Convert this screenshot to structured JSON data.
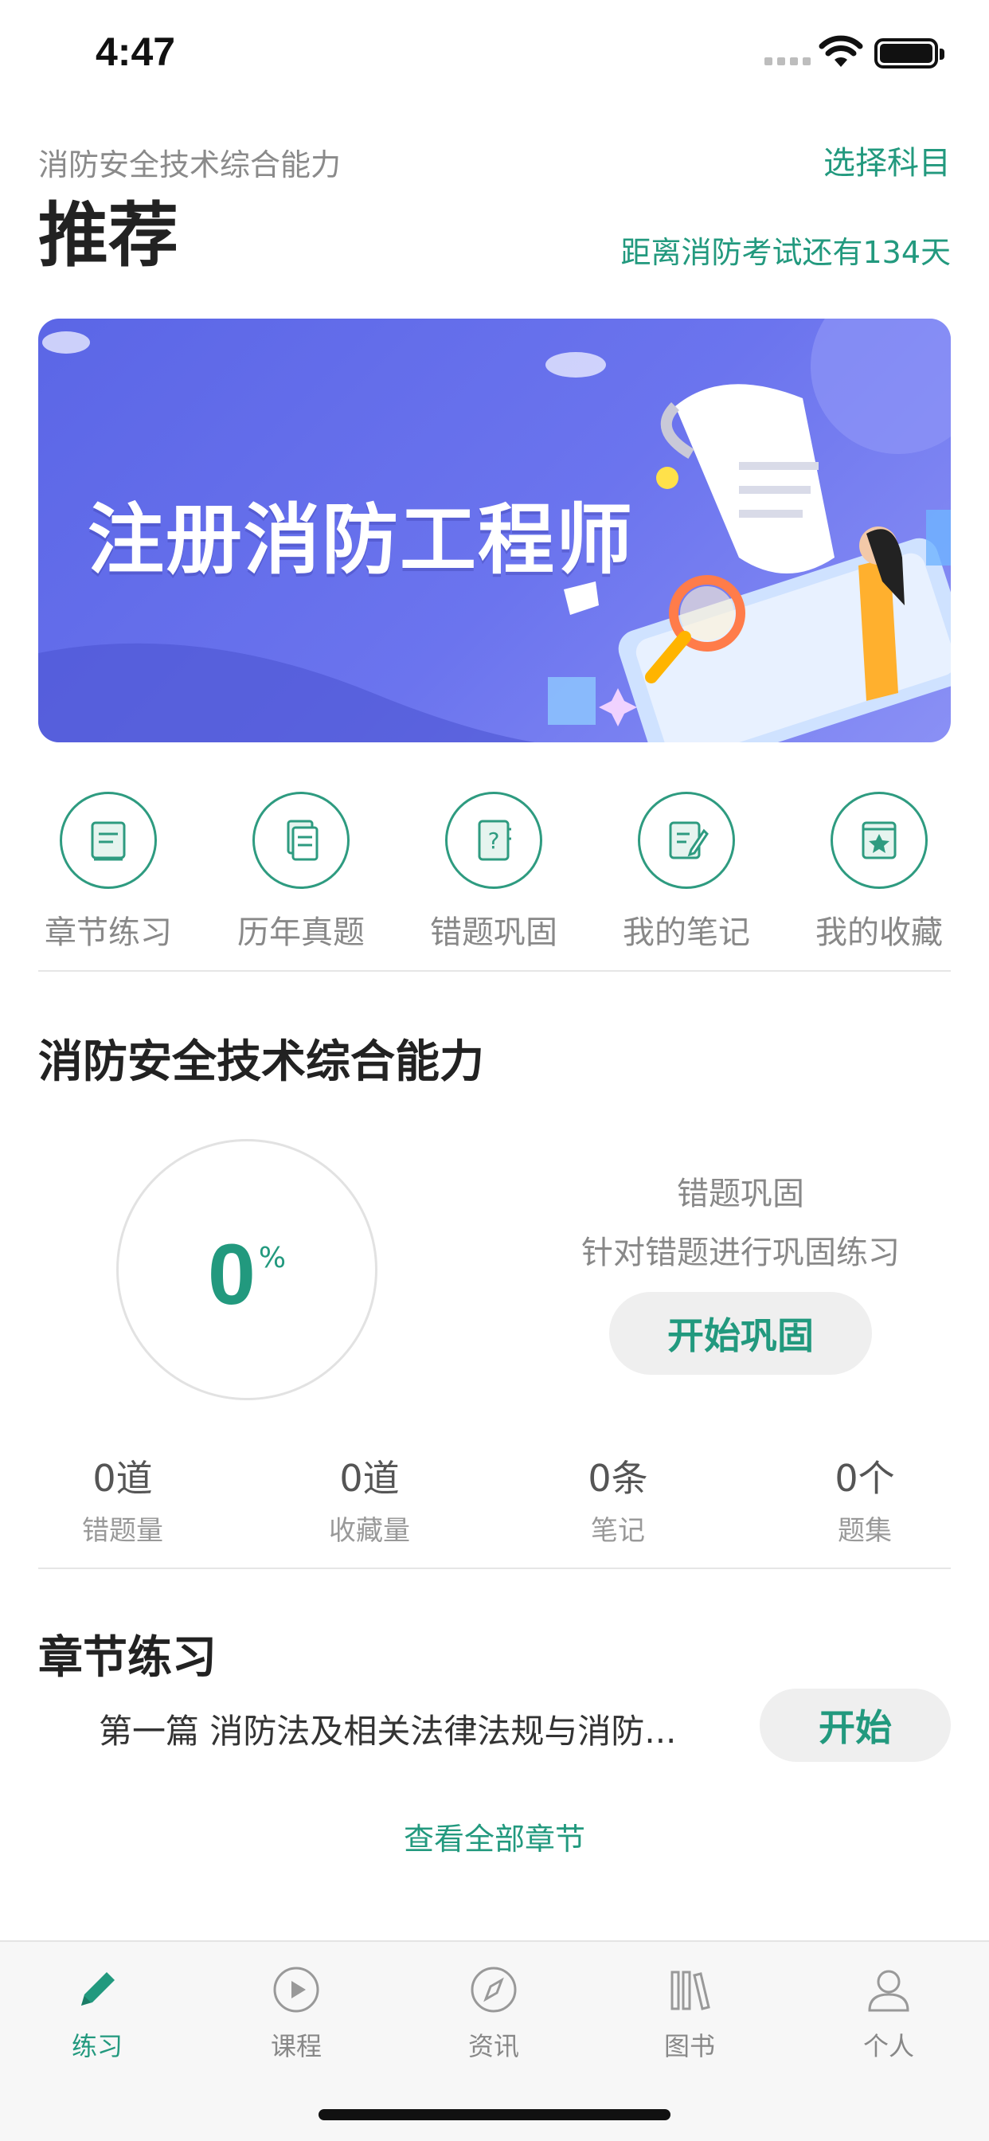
{
  "status_bar": {
    "time": "4:47"
  },
  "header": {
    "subject": "消防安全技术综合能力",
    "choose_subject": "选择科目",
    "title": "推荐",
    "countdown": "距离消防考试还有134天"
  },
  "banner": {
    "headline": "注册消防工程师"
  },
  "quick_actions": [
    {
      "label": "章节练习",
      "icon": "scroll-pen-icon"
    },
    {
      "label": "历年真题",
      "icon": "documents-icon"
    },
    {
      "label": "错题巩固",
      "icon": "question-notebook-icon"
    },
    {
      "label": "我的笔记",
      "icon": "note-edit-icon"
    },
    {
      "label": "我的收藏",
      "icon": "star-book-icon"
    }
  ],
  "stats": {
    "title": "消防安全技术综合能力",
    "progress_value": "0",
    "progress_unit": "%",
    "wrong_title": "错题巩固",
    "wrong_desc": "针对错题进行巩固练习",
    "wrong_button": "开始巩固",
    "counts": [
      {
        "value": "0道",
        "label": "错题量"
      },
      {
        "value": "0道",
        "label": "收藏量"
      },
      {
        "value": "0条",
        "label": "笔记"
      },
      {
        "value": "0个",
        "label": "题集"
      }
    ]
  },
  "chapter": {
    "title": "章节练习",
    "item_name": "第一篇 消防法及相关法律法规与消防...",
    "start_button": "开始",
    "view_all": "查看全部章节"
  },
  "tabbar": [
    {
      "label": "练习",
      "icon": "pencil-icon",
      "active": true
    },
    {
      "label": "课程",
      "icon": "play-circle-icon",
      "active": false
    },
    {
      "label": "资讯",
      "icon": "compass-icon",
      "active": false
    },
    {
      "label": "图书",
      "icon": "books-icon",
      "active": false
    },
    {
      "label": "个人",
      "icon": "person-icon",
      "active": false
    }
  ],
  "colors": {
    "accent": "#22997e",
    "banner": "#5b66e6"
  }
}
